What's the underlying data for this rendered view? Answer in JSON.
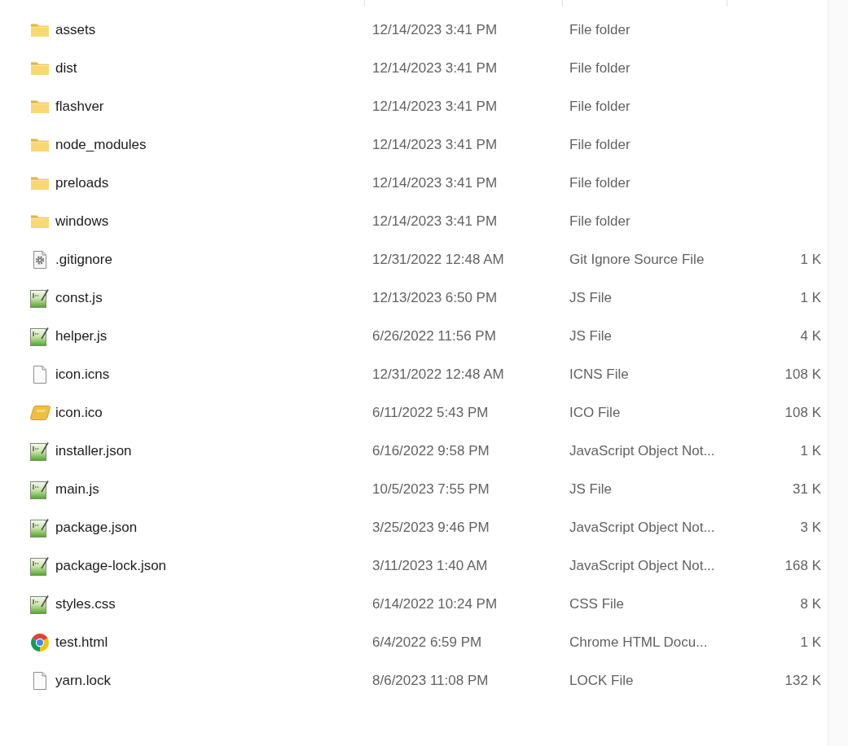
{
  "file_list": {
    "rows": [
      {
        "kind": "folder",
        "name": "assets",
        "date_modified": "12/14/2023 3:41 PM",
        "type": "File folder"
      },
      {
        "kind": "folder",
        "name": "dist",
        "date_modified": "12/14/2023 3:41 PM",
        "type": "File folder"
      },
      {
        "kind": "folder",
        "name": "flashver",
        "date_modified": "12/14/2023 3:41 PM",
        "type": "File folder"
      },
      {
        "kind": "folder",
        "name": "node_modules",
        "date_modified": "12/14/2023 3:41 PM",
        "type": "File folder"
      },
      {
        "kind": "folder",
        "name": "preloads",
        "date_modified": "12/14/2023 3:41 PM",
        "type": "File folder"
      },
      {
        "kind": "folder",
        "name": "windows",
        "date_modified": "12/14/2023 3:41 PM",
        "type": "File folder"
      },
      {
        "kind": "settings",
        "name": ".gitignore",
        "date_modified": "12/31/2022 12:48 AM",
        "type": "Git Ignore Source File",
        "size": "1 K"
      },
      {
        "kind": "script",
        "name": "const.js",
        "date_modified": "12/13/2023 6:50 PM",
        "type": "JS File",
        "size": "1 K"
      },
      {
        "kind": "script",
        "name": "helper.js",
        "date_modified": "6/26/2022 11:56 PM",
        "type": "JS File",
        "size": "4 K"
      },
      {
        "kind": "blank",
        "name": "icon.icns",
        "date_modified": "12/31/2022 12:48 AM",
        "type": "ICNS File",
        "size": "108 K"
      },
      {
        "kind": "image",
        "name": "icon.ico",
        "date_modified": "6/11/2022 5:43 PM",
        "type": "ICO File",
        "size": "108 K"
      },
      {
        "kind": "script",
        "name": "installer.json",
        "date_modified": "6/16/2022 9:58 PM",
        "type": "JavaScript Object Not...",
        "size": "1 K"
      },
      {
        "kind": "script",
        "name": "main.js",
        "date_modified": "10/5/2023 7:55 PM",
        "type": "JS File",
        "size": "31 K"
      },
      {
        "kind": "script",
        "name": "package.json",
        "date_modified": "3/25/2023 9:46 PM",
        "type": "JavaScript Object Not...",
        "size": "3 K"
      },
      {
        "kind": "script",
        "name": "package-lock.json",
        "date_modified": "3/11/2023 1:40 AM",
        "type": "JavaScript Object Not...",
        "size": "168 K"
      },
      {
        "kind": "script",
        "name": "styles.css",
        "date_modified": "6/14/2022 10:24 PM",
        "type": "CSS File",
        "size": "8 K"
      },
      {
        "kind": "browser",
        "name": "test.html",
        "date_modified": "6/4/2022 6:59 PM",
        "type": "Chrome HTML Docu...",
        "size": "1 K"
      },
      {
        "kind": "blank",
        "name": "yarn.lock",
        "date_modified": "8/6/2023 11:08 PM",
        "type": "LOCK File",
        "size": "132 K"
      }
    ]
  }
}
